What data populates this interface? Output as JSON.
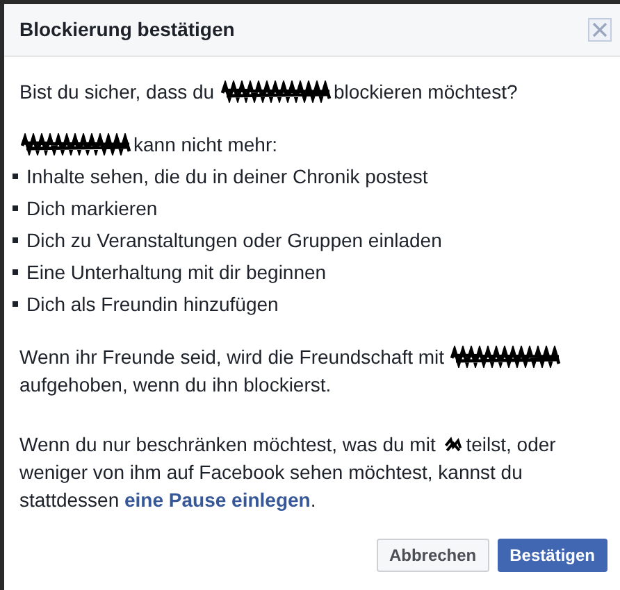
{
  "dialog": {
    "title": "Blockierung bestätigen"
  },
  "intro": [
    {
      "kind": "text",
      "text": "Bist du sicher, dass du"
    },
    {
      "kind": "redaction"
    },
    {
      "kind": "text",
      "text": "blockieren möchtest?"
    }
  ],
  "lead": [
    {
      "kind": "redaction"
    },
    {
      "kind": "text",
      "text": "kann nicht mehr:"
    }
  ],
  "items": [
    "Inhalte sehen, die du in deiner Chronik postest",
    "Dich markieren",
    "Dich zu Veranstaltungen oder Gruppen einladen",
    "Eine Unterhaltung mit dir beginnen",
    "Dich als Freundin hinzufügen"
  ],
  "paragraphs": [
    [
      {
        "kind": "text",
        "text": "Wenn ihr Freunde seid, wird die Freundschaft mit"
      },
      {
        "kind": "redaction"
      },
      {
        "kind": "text",
        "text": "aufgehoben, wenn du ihn blockierst."
      }
    ],
    [
      {
        "kind": "text",
        "text": "Wenn du nur beschränken möchtest, was du mit"
      },
      {
        "kind": "redaction_small"
      },
      {
        "kind": "text",
        "text": "teilst, oder"
      },
      {
        "kind": "text",
        "text": "weniger von ihm auf Facebook sehen möchtest, kannst du"
      },
      {
        "kind": "text",
        "text": "stattdessen"
      },
      {
        "kind": "link",
        "text": "eine Pause einlegen"
      },
      {
        "kind": "text",
        "text": "."
      }
    ]
  ],
  "buttons": [
    {
      "label": "Abbrechen",
      "primary": false
    },
    {
      "label": "Bestätigen",
      "primary": true
    }
  ]
}
